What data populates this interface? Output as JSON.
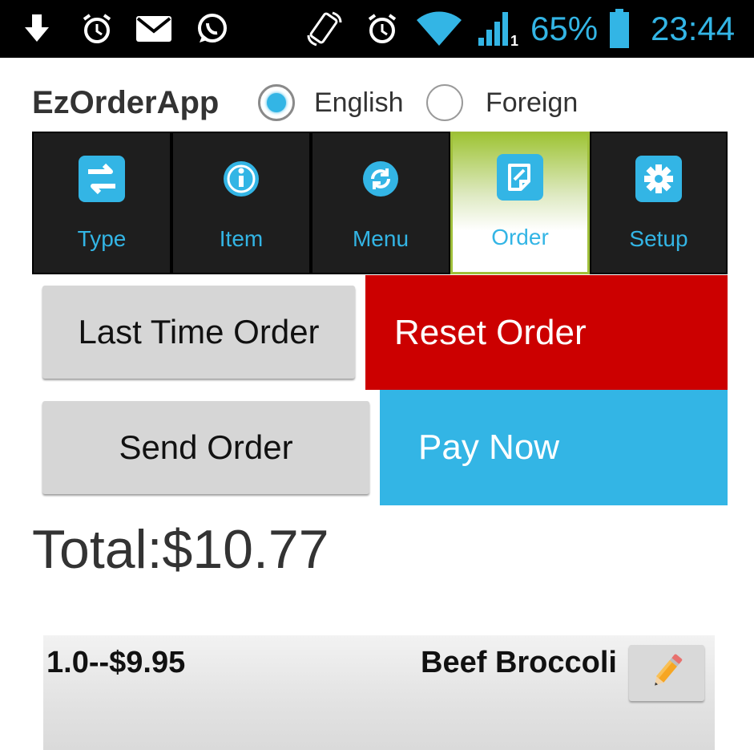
{
  "status_bar": {
    "battery_percent": "65%",
    "time": "23:44",
    "icons": [
      "download-icon",
      "alarm-icon",
      "mail-icon",
      "whatsapp-icon",
      "rotation-icon",
      "alarm-icon",
      "wifi-icon",
      "signal-icon",
      "battery-icon"
    ]
  },
  "header": {
    "app_title": "EzOrderApp",
    "language_options": [
      {
        "label": "English",
        "selected": true
      },
      {
        "label": "Foreign",
        "selected": false
      }
    ]
  },
  "tabs": [
    {
      "label": "Type",
      "icon": "swap-icon",
      "active": false
    },
    {
      "label": "Item",
      "icon": "info-icon",
      "active": false
    },
    {
      "label": "Menu",
      "icon": "refresh-icon",
      "active": false
    },
    {
      "label": "Order",
      "icon": "order-note-icon",
      "active": true
    },
    {
      "label": "Setup",
      "icon": "gear-icon",
      "active": false
    }
  ],
  "actions": {
    "last_time_order": "Last Time Order",
    "reset_order": "Reset Order",
    "send_order": "Send Order",
    "pay_now": "Pay Now"
  },
  "total": "Total:$10.77",
  "order_items": [
    {
      "qty_price": "1.0--$9.95",
      "name": "Beef Broccoli",
      "edit_icon": "pencil-icon"
    }
  ],
  "colors": {
    "accent": "#33b5e5",
    "reset_red": "#cc0000",
    "active_tab_green": "#9fc436"
  }
}
